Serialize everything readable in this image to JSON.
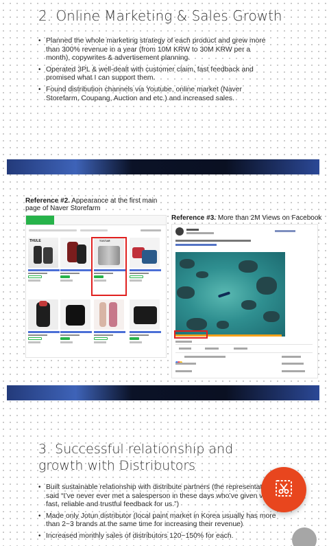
{
  "section1": {
    "title": "2. Online Marketing & Sales Growth",
    "bullets": [
      "Planned the whole marketing strategy of each product and grew more than 300% revenue in a year (from 10M KRW to 30M KRW per a month), copywrites & advertisement planning.",
      "Operated 3PL & well-dealt with customer claim, fast feedback and promised what I can support them.",
      "Found distribution channels via Youtube, online market (Naver Storefarm, Coupang, Auction and etc.) and increased sales."
    ]
  },
  "references": {
    "ref2": {
      "label": "Reference #2.",
      "caption": "Appearance at the first main page of Naver Storefarm"
    },
    "ref3": {
      "label": "Reference #3.",
      "caption": "More than 2M Views on Facebook"
    }
  },
  "naver": {
    "brand_thule": "THULE",
    "brand_tostar": "TOSTAR"
  },
  "section2": {
    "title": "3. Successful relationship and growth with Distributors",
    "bullets": [
      "Built sustainable relationship with distribute partners (the representative said “I’ve never ever met a salesperson in these days who’ve given very fast, reliable and trustful feedback  for us.”)",
      "Made only Jotun distributor (local paint market in Korea usually has more than 2~3 brands at the same time for increasing their revenue)",
      "Increased monthly sales of distributors 120~150% for each."
    ]
  },
  "icons": {
    "capture": "screen-capture-icon"
  },
  "colors": {
    "capture_button": "#e8461e",
    "highlight_box": "#e0201f",
    "naver_green": "#27b34a"
  }
}
